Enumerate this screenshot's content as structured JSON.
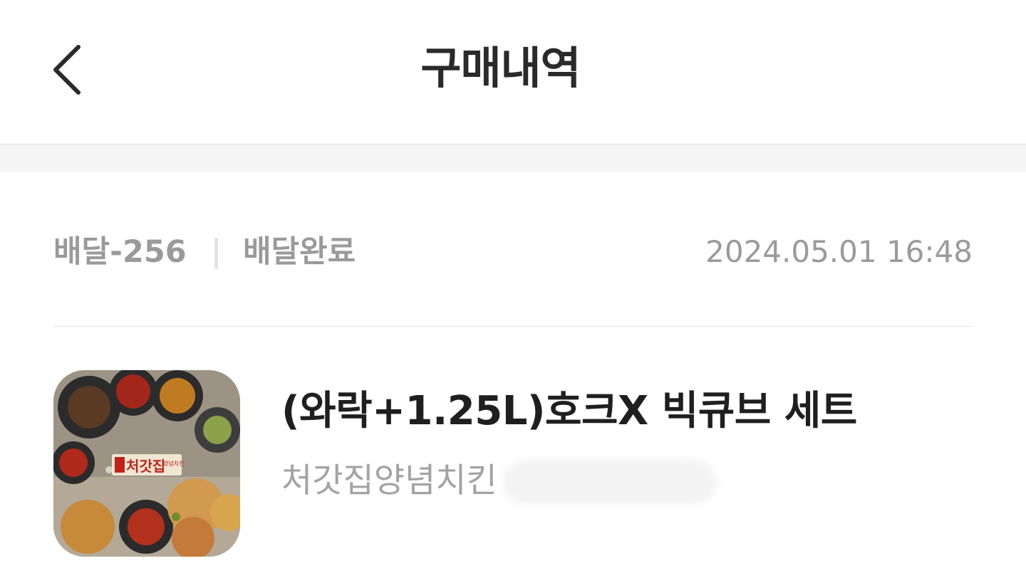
{
  "header": {
    "title": "구매내역",
    "back_icon": "chevron-left-icon"
  },
  "order": {
    "id": "배달-256",
    "status": "배달완료",
    "datetime": "2024.05.01 16:48"
  },
  "product": {
    "name": "(와락+1.25L)호크X 빅큐브 세트",
    "store": "처갓집양념치킨",
    "thumbnail_logo_text": "처갓집",
    "thumbnail_logo_subtext": "양념치킨"
  },
  "colors": {
    "title": "#2a2a2a",
    "muted": "#9a9a9a",
    "divider": "#e3e3e3",
    "band": "#f5f5f5"
  }
}
